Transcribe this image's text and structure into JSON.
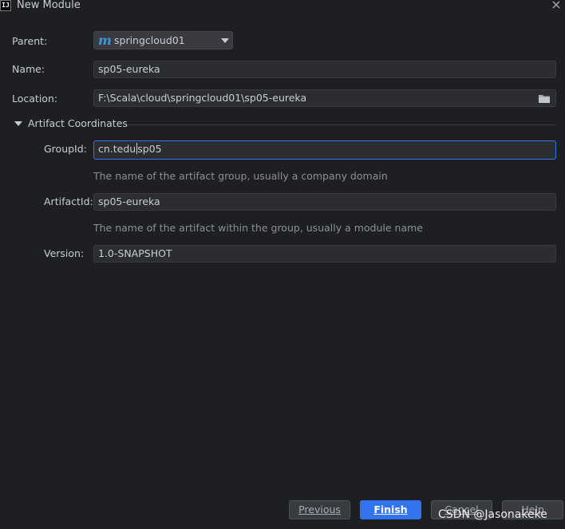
{
  "window": {
    "app_icon_text": "IJ",
    "title": "New Module",
    "close_glyph": "×"
  },
  "form": {
    "parent": {
      "label": "Parent:",
      "value": "springcloud01",
      "icon": "maven-icon",
      "icon_glyph": "m"
    },
    "name": {
      "label": "Name:",
      "value": "sp05-eureka"
    },
    "location": {
      "label": "Location:",
      "value": "F:\\Scala\\cloud\\springcloud01\\sp05-eureka",
      "icon": "folder-icon"
    }
  },
  "artifact": {
    "section_title": "Artifact Coordinates",
    "group_id": {
      "label": "GroupId:",
      "value_before_caret": "cn.tedu",
      "value_after_caret": "sp05",
      "hint": "The name of the artifact group, usually a company domain"
    },
    "artifact_id": {
      "label": "ArtifactId:",
      "value": "sp05-eureka",
      "hint": "The name of the artifact within the group, usually a module name"
    },
    "version": {
      "label": "Version:",
      "value": "1.0-SNAPSHOT"
    }
  },
  "buttons": {
    "previous": "Previous",
    "finish": "Finish",
    "cancel": "Cancel",
    "help": "Help"
  },
  "watermark": "CSDN @Jasonakeke",
  "colors": {
    "background": "#1e1f22",
    "field_background": "#2b2d30",
    "accent": "#3574f0",
    "maven_icon": "#3d9ad8"
  }
}
